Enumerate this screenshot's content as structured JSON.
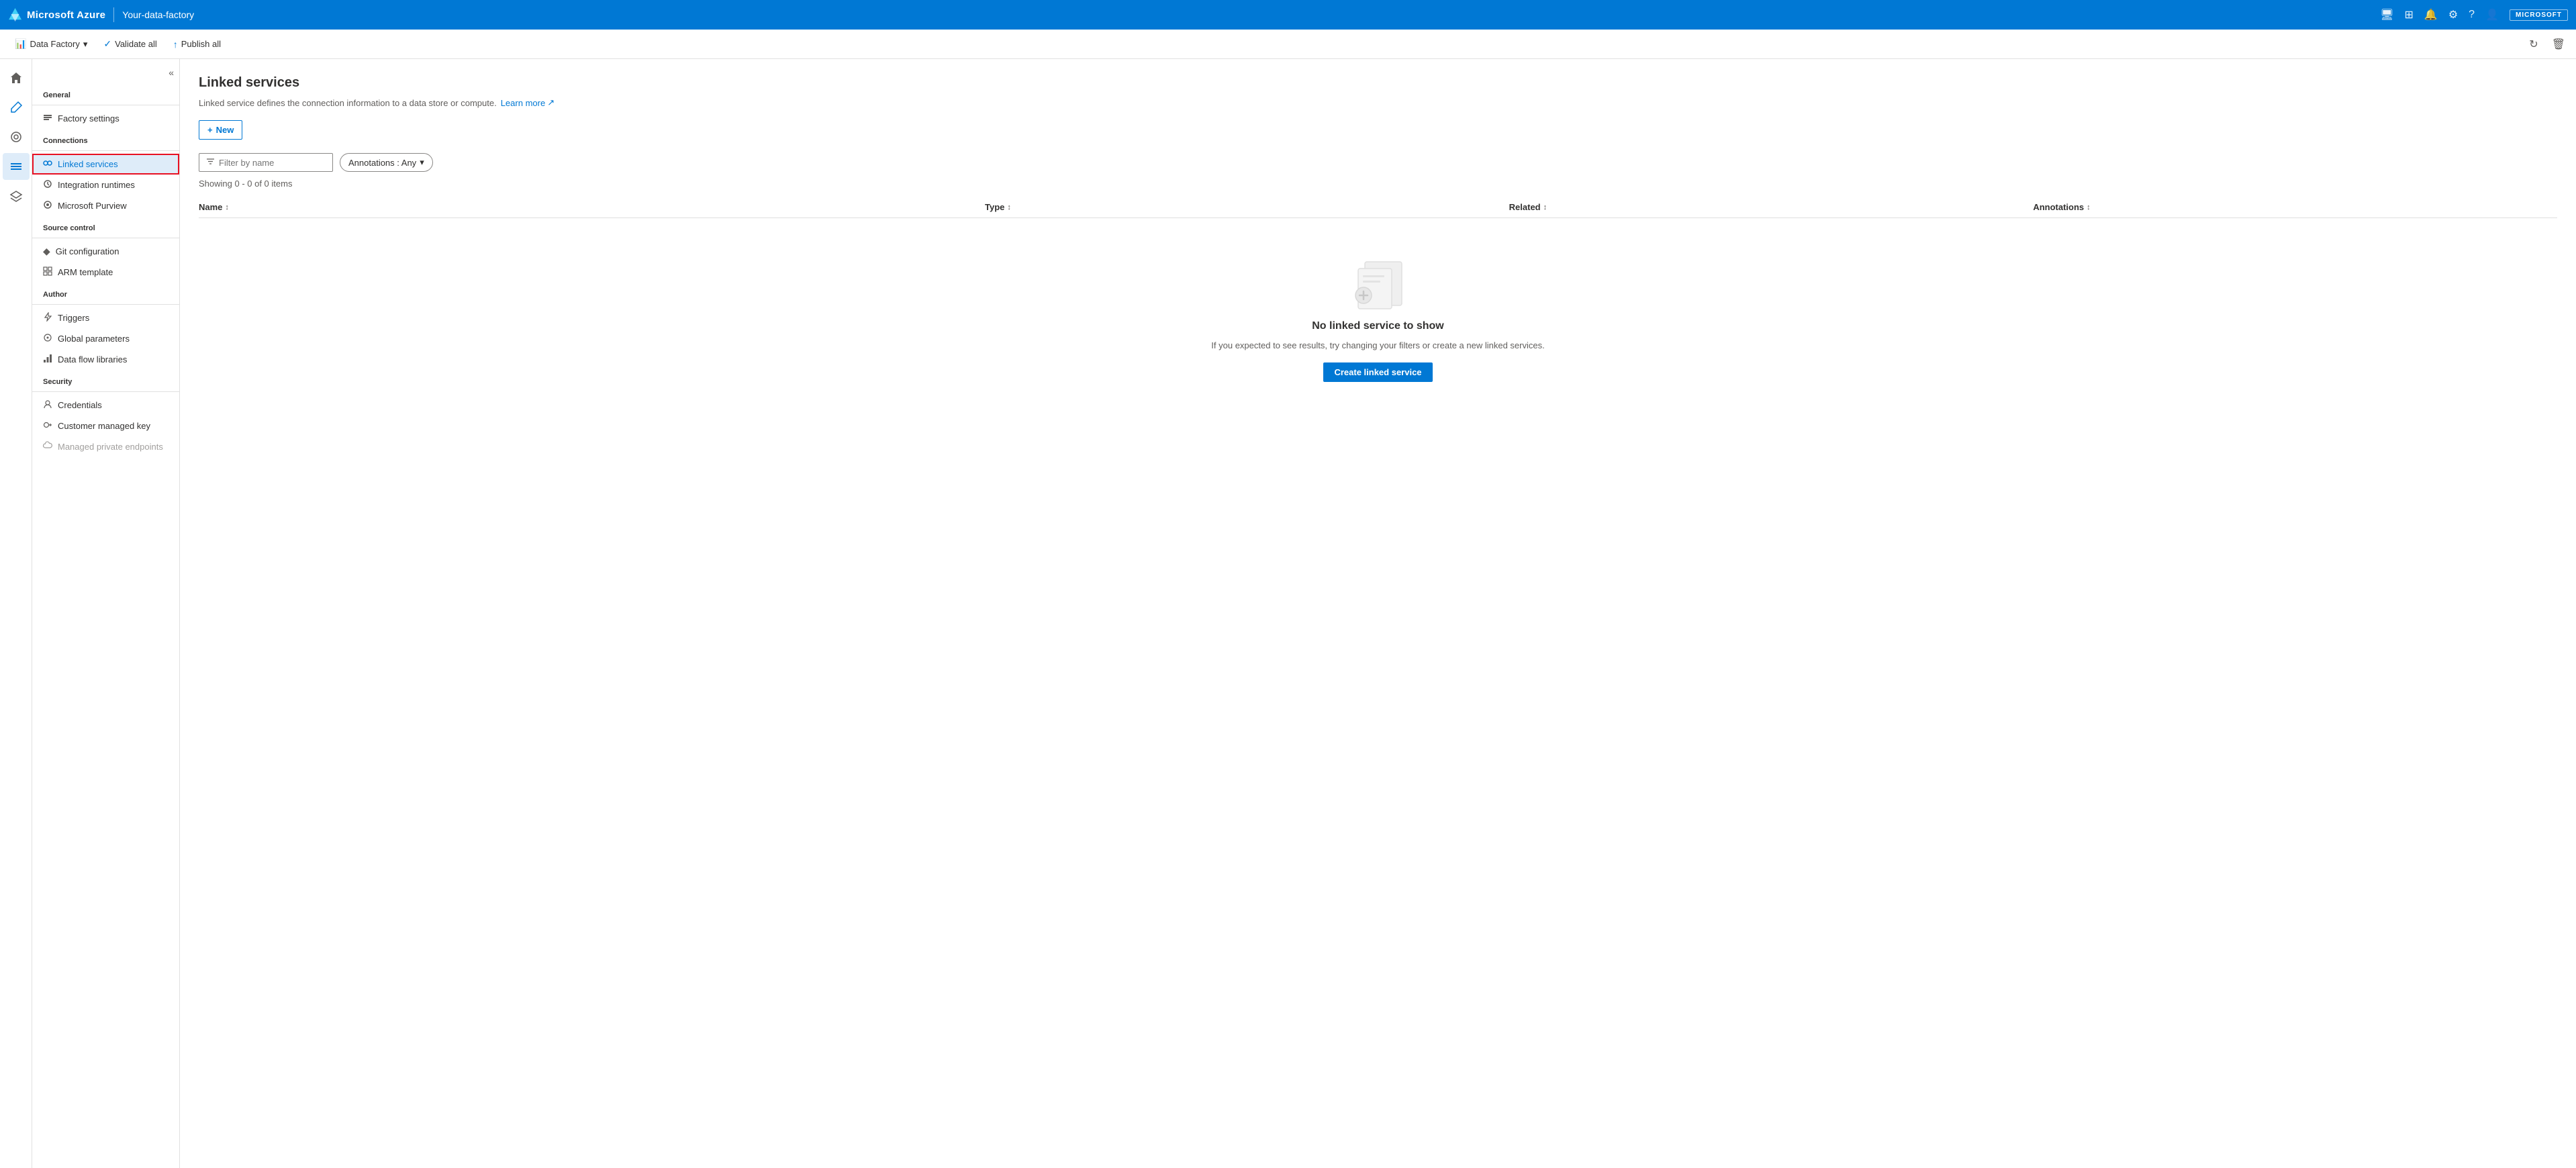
{
  "topbar": {
    "brand": "Microsoft Azure",
    "separator": "|",
    "factory_name": "Your-data-factory",
    "ms_badge": "MICROSOFT",
    "icons": [
      "monitor-icon",
      "grid-icon",
      "bell-icon",
      "gear-icon",
      "help-icon",
      "user-icon"
    ]
  },
  "toolbar": {
    "data_factory_label": "Data Factory",
    "validate_all_label": "Validate all",
    "publish_all_label": "Publish all",
    "refresh_label": "Refresh",
    "discard_label": "Discard"
  },
  "icon_sidebar": {
    "items": [
      {
        "name": "home-icon",
        "symbol": "⌂",
        "active": false
      },
      {
        "name": "pencil-icon",
        "symbol": "✏",
        "active": false
      },
      {
        "name": "monitor-icon-side",
        "symbol": "◎",
        "active": false
      },
      {
        "name": "manage-icon",
        "symbol": "🧰",
        "active": true
      },
      {
        "name": "learn-icon",
        "symbol": "🎓",
        "active": false
      }
    ]
  },
  "nav_sidebar": {
    "general_label": "General",
    "general_items": [
      {
        "name": "factory-settings",
        "label": "Factory settings",
        "icon": "⚙"
      }
    ],
    "connections_label": "Connections",
    "connections_items": [
      {
        "name": "linked-services",
        "label": "Linked services",
        "icon": "🔗",
        "active": true
      },
      {
        "name": "integration-runtimes",
        "label": "Integration runtimes",
        "icon": "⚙"
      },
      {
        "name": "microsoft-purview",
        "label": "Microsoft Purview",
        "icon": "👁"
      }
    ],
    "source_control_label": "Source control",
    "source_control_items": [
      {
        "name": "git-configuration",
        "label": "Git configuration",
        "icon": "◆"
      },
      {
        "name": "arm-template",
        "label": "ARM template",
        "icon": "⊞"
      }
    ],
    "author_label": "Author",
    "author_items": [
      {
        "name": "triggers",
        "label": "Triggers",
        "icon": "⚡"
      },
      {
        "name": "global-parameters",
        "label": "Global parameters",
        "icon": "⊙"
      },
      {
        "name": "data-flow-libraries",
        "label": "Data flow libraries",
        "icon": "📊"
      }
    ],
    "security_label": "Security",
    "security_items": [
      {
        "name": "credentials",
        "label": "Credentials",
        "icon": "👤"
      },
      {
        "name": "customer-managed-key",
        "label": "Customer managed key",
        "icon": "🔑"
      },
      {
        "name": "managed-private-endpoints",
        "label": "Managed private endpoints",
        "icon": "☁",
        "disabled": true
      }
    ]
  },
  "main": {
    "page_title": "Linked services",
    "description": "Linked service defines the connection information to a data store or compute.",
    "learn_more": "Learn more",
    "new_button": "New",
    "filter_placeholder": "Filter by name",
    "annotations_label": "Annotations : Any",
    "showing_count": "Showing 0 - 0 of 0 items",
    "table": {
      "columns": [
        {
          "name": "Name",
          "sort": "↕"
        },
        {
          "name": "Type",
          "sort": "↕"
        },
        {
          "name": "Related",
          "sort": "↕"
        },
        {
          "name": "Annotations",
          "sort": "↕"
        }
      ]
    },
    "empty_state": {
      "title": "No linked service to show",
      "subtitle": "If you expected to see results, try changing your filters or create a new linked services.",
      "create_button": "Create linked service"
    }
  }
}
